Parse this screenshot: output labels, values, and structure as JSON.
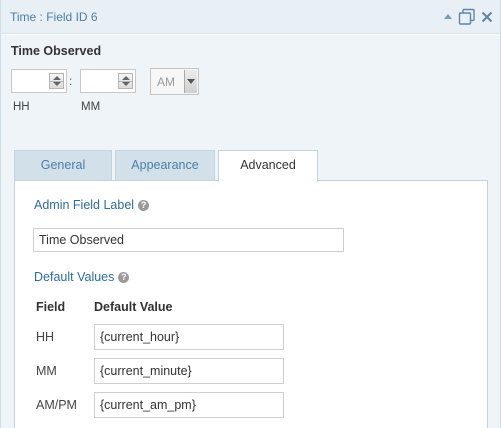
{
  "titlebar": {
    "title": "Time : Field ID 6",
    "icons": [
      "collapse-arrow-icon",
      "duplicate-icon",
      "close-icon"
    ]
  },
  "field": {
    "label": "Time Observed",
    "hour_value": "",
    "minute_value": "",
    "separator": ":",
    "ampm_value": "AM",
    "hh_label": "HH",
    "mm_label": "MM"
  },
  "tabs": [
    {
      "label": "General",
      "active": false
    },
    {
      "label": "Appearance",
      "active": false
    },
    {
      "label": "Advanced",
      "active": true
    }
  ],
  "advanced": {
    "admin_label_heading": "Admin Field Label",
    "admin_label_value": "Time Observed",
    "default_values_heading": "Default Values",
    "col_field": "Field",
    "col_default": "Default Value",
    "rows": [
      {
        "field": "HH",
        "value": "{current_hour}"
      },
      {
        "field": "MM",
        "value": "{current_minute}"
      },
      {
        "field": "AM/PM",
        "value": "{current_am_pm}"
      }
    ]
  },
  "colors": {
    "title_text": "#4b7ea6",
    "heading_blue": "#2e6d9e",
    "panel_bg": "#eef4f8",
    "tab_inactive_bg": "#d2e0ea"
  }
}
